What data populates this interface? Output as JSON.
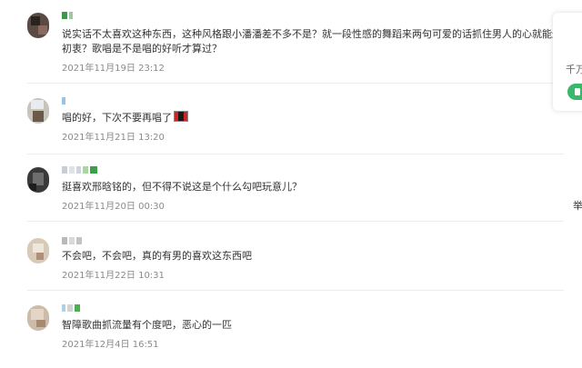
{
  "comments": [
    {
      "text": "说实话不太喜欢这种东西，这种风格跟小潘潘差不多不是？就一段性感的舞蹈来两句可爱的话抓住男人的心就能过关，但我想问初衷？歌唱是不是唱的好听才算过？",
      "time": "2021年11月19日 23:12"
    },
    {
      "text": "唱的好，下次不要再唱了",
      "time": "2021年11月21日 13:20"
    },
    {
      "text": "挺喜欢邢晗铭的，但不得不说这是个什么勾吧玩意儿？",
      "time": "2021年11月20日 00:30"
    },
    {
      "text": "不会吧，不会吧，真的有男的喜欢这东西吧",
      "time": "2021年11月22日 10:31"
    },
    {
      "text": "智障歌曲抓流量有个度吧，恶心的一匹",
      "time": "2021年12月4日 16:51"
    }
  ],
  "side_card": {
    "label": "千万"
  },
  "side_label": "举",
  "colors": {
    "accent_green": "#39b86c",
    "time_gray": "#8a8a8a",
    "divider": "#ececec"
  }
}
